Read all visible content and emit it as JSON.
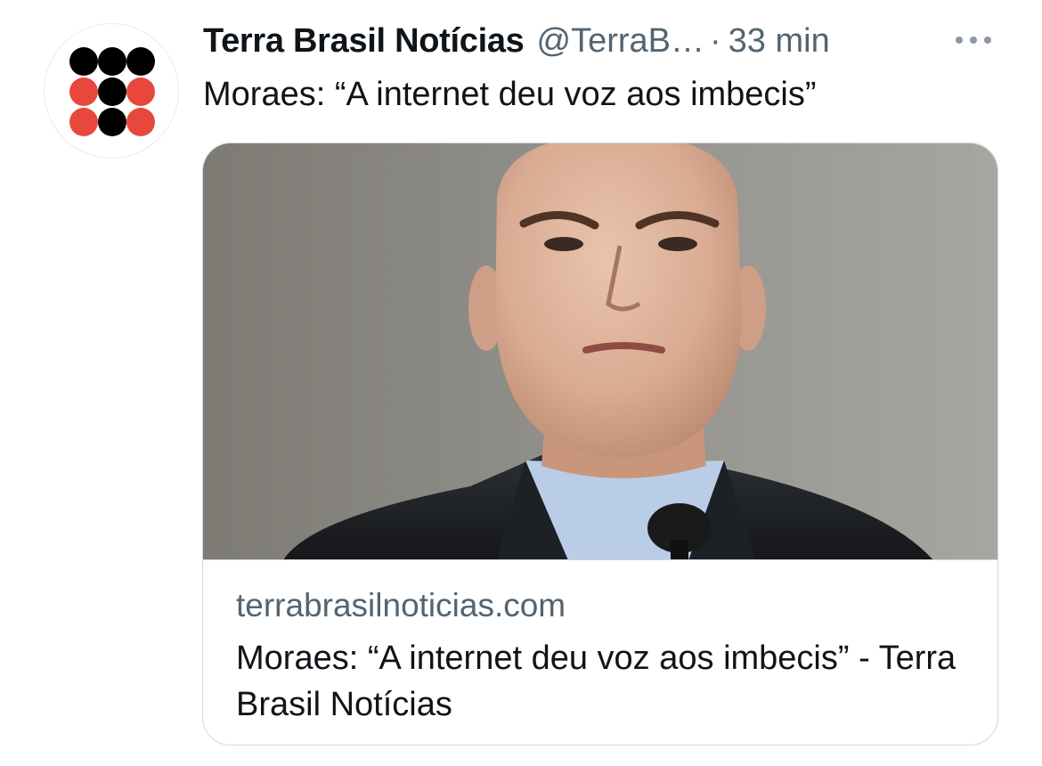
{
  "tweet": {
    "author": {
      "display_name": "Terra Brasil Notícias",
      "handle": "@TerraB…",
      "avatar_icon": "nine-dot-grid-logo",
      "avatar_colors": {
        "black": "#000000",
        "red": "#e8483c"
      }
    },
    "separator": "·",
    "timestamp": "33 min",
    "more_icon": "more-horizontal-icon",
    "text": "Moraes: “A internet deu voz aos imbecis”",
    "card": {
      "image_alt": "portrait-photo",
      "domain": "terrabrasilnoticias.com",
      "title": "Moraes: “A internet deu voz aos imbecis” - Terra Brasil Notícias"
    }
  },
  "colors": {
    "text_primary": "#0f1419",
    "text_secondary": "#536471",
    "border": "#cfd9de"
  }
}
